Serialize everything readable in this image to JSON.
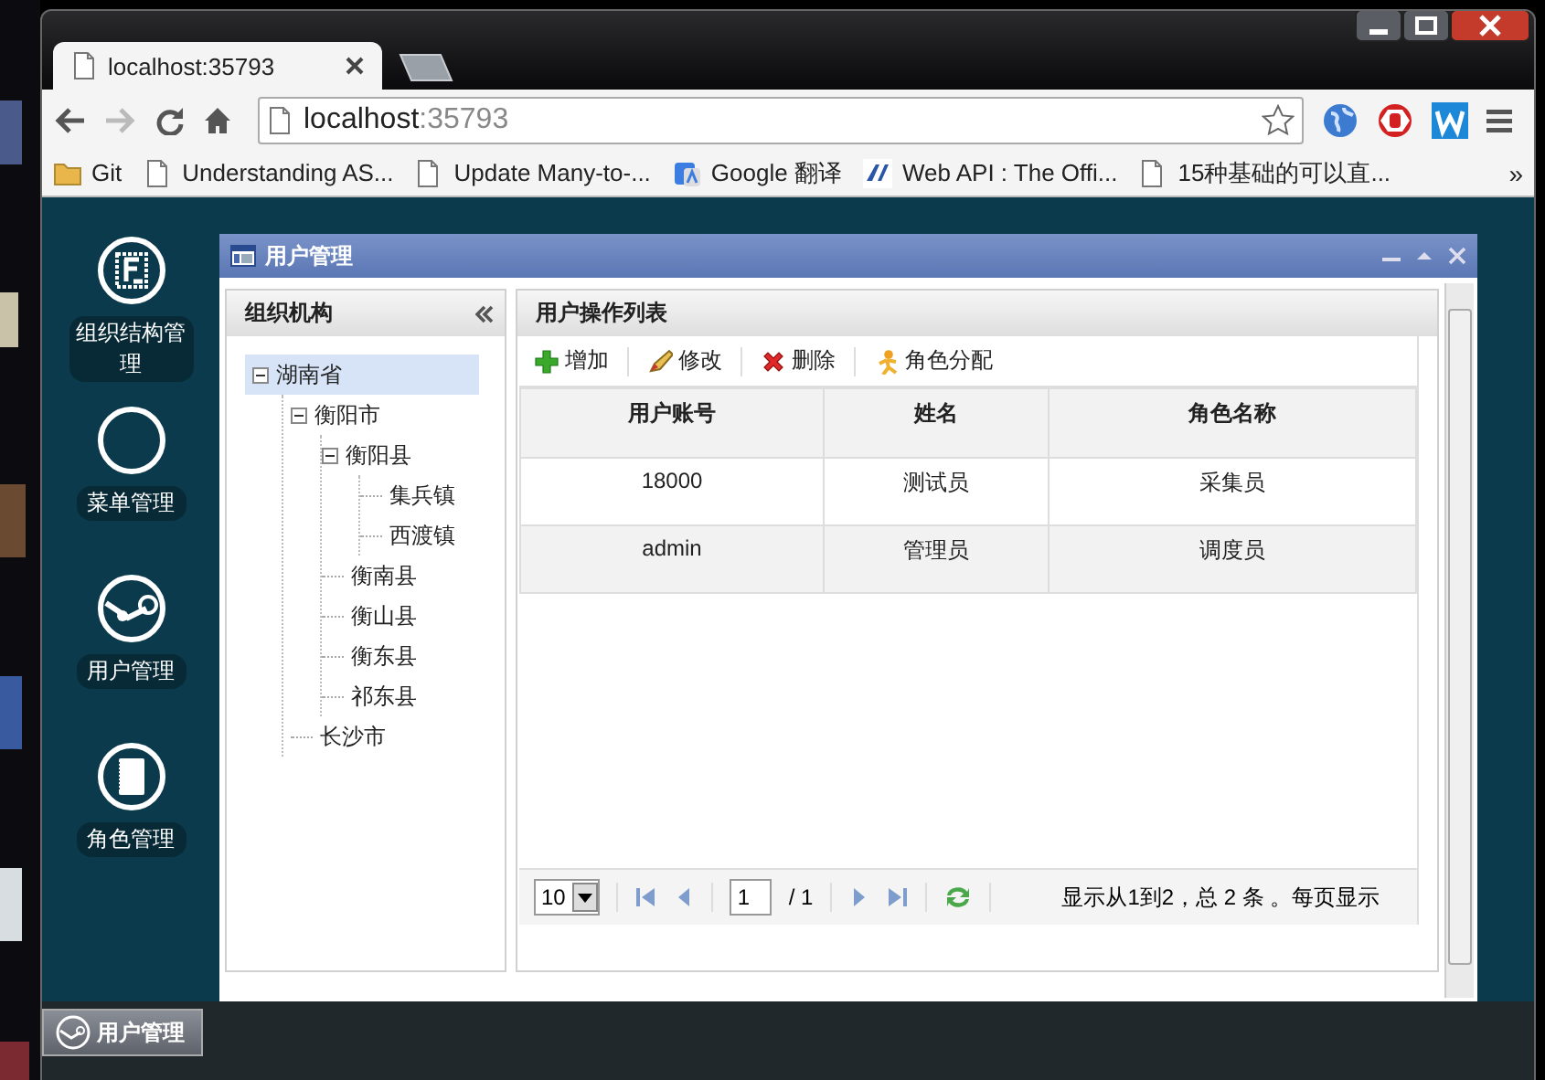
{
  "browser": {
    "tab": {
      "title": "localhost:35793"
    },
    "address": {
      "host": "localhost",
      "port": ":35793"
    },
    "bookmarks": [
      {
        "label": "Git",
        "kind": "folder"
      },
      {
        "label": "Understanding AS...",
        "kind": "page"
      },
      {
        "label": "Update Many-to-...",
        "kind": "page"
      },
      {
        "label": "Google 翻译",
        "kind": "translate"
      },
      {
        "label": "Web API : The Offi...",
        "kind": "aspnet"
      },
      {
        "label": "15种基础的可以直...",
        "kind": "page"
      }
    ],
    "more": "»"
  },
  "sidebar": {
    "items": [
      {
        "label": "组织结构管理"
      },
      {
        "label": "菜单管理"
      },
      {
        "label": "用户管理"
      },
      {
        "label": "角色管理"
      }
    ]
  },
  "dialog": {
    "title": "用户管理",
    "tree_panel": {
      "title": "组织机构",
      "tree": [
        {
          "label": "湖南省",
          "selected": true,
          "expanded": true,
          "children": [
            {
              "label": "衡阳市",
              "selected": false,
              "expanded": true,
              "children": [
                {
                  "label": "衡阳县",
                  "selected": false,
                  "expanded": true,
                  "children": [
                    {
                      "label": "集兵镇",
                      "selected": false
                    },
                    {
                      "label": "西渡镇",
                      "selected": false
                    }
                  ]
                },
                {
                  "label": "衡南县",
                  "selected": false
                },
                {
                  "label": "衡山县",
                  "selected": false
                },
                {
                  "label": "衡东县",
                  "selected": false
                },
                {
                  "label": "祁东县",
                  "selected": false
                }
              ]
            },
            {
              "label": "长沙市",
              "selected": false
            }
          ]
        }
      ]
    },
    "list_panel": {
      "title": "用户操作列表",
      "toolbar": [
        {
          "label": "增加",
          "kind": "add"
        },
        {
          "label": "修改",
          "kind": "edit"
        },
        {
          "label": "删除",
          "kind": "delete"
        },
        {
          "label": "角色分配",
          "kind": "role"
        }
      ],
      "table": {
        "columns": [
          "用户账号",
          "姓名",
          "角色名称"
        ],
        "rows": [
          [
            "18000",
            "测试员",
            "采集员"
          ],
          [
            "admin",
            "管理员",
            "调度员"
          ]
        ]
      },
      "pager": {
        "page_size": "10",
        "page": "1",
        "total_pages": "/ 1",
        "info": "显示从1到2，总 2 条 。每页显示"
      }
    }
  },
  "taskbar": {
    "button": "用户管理"
  }
}
